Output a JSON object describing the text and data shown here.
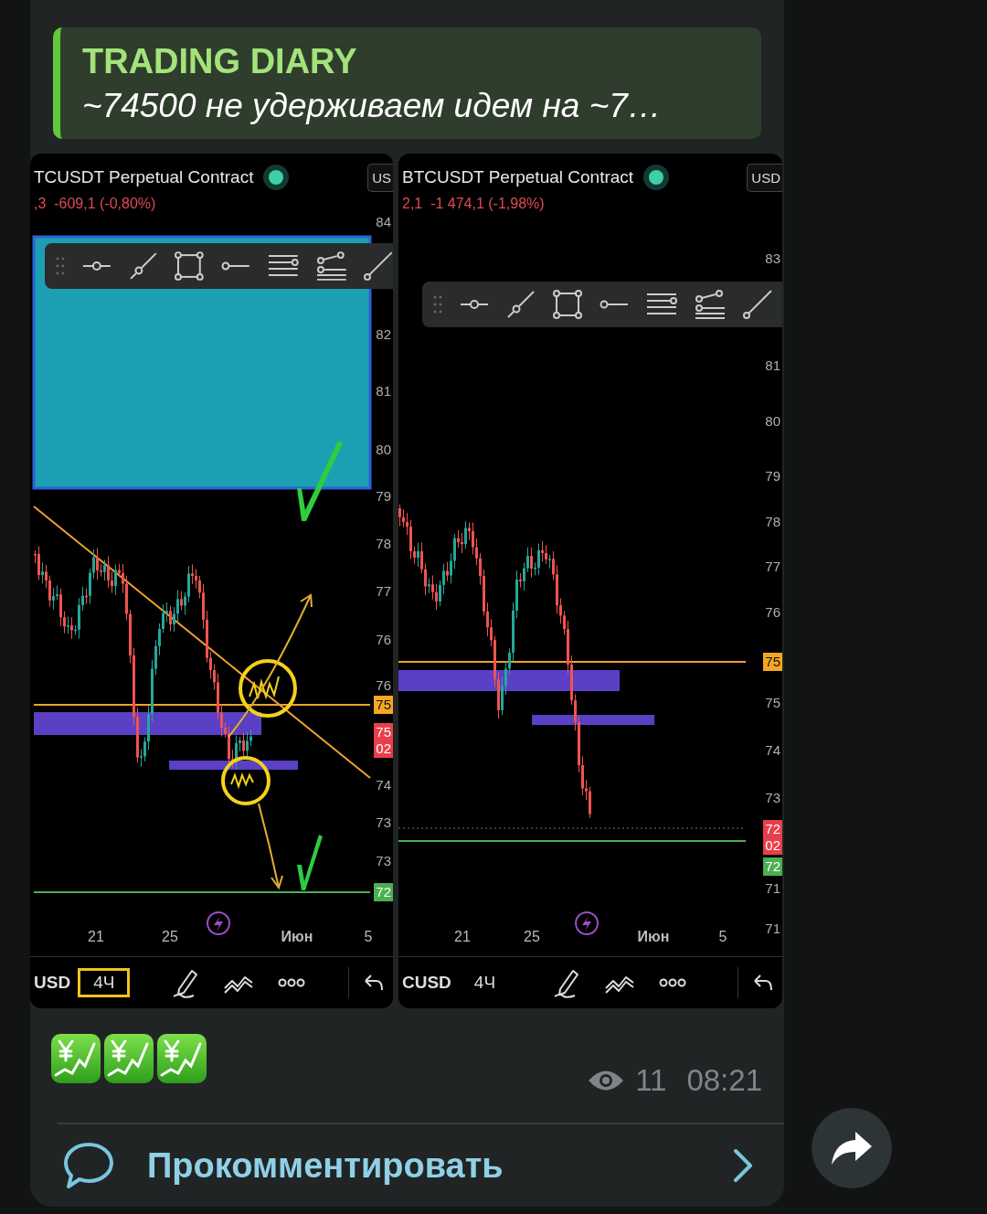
{
  "reply": {
    "title": "TRADING DIARY",
    "text": "~74500 не удерживаем идем на ~7…"
  },
  "charts": [
    {
      "title": "TCUSDT Perpetual Contract",
      "change": ",3  -609,1 (-0,80%)",
      "currency": "US",
      "symbol": "USD",
      "timeframe": {
        "label": "4Ч",
        "selected": true
      },
      "dates": [
        "21",
        "25",
        "Июн",
        "5"
      ],
      "price_labels": [
        {
          "lines": [
            "84"
          ],
          "kind": "plain"
        },
        {
          "lines": [
            "82"
          ],
          "kind": "plain"
        },
        {
          "lines": [
            "81"
          ],
          "kind": "plain"
        },
        {
          "lines": [
            "80"
          ],
          "kind": "plain"
        },
        {
          "lines": [
            "79"
          ],
          "kind": "plain"
        },
        {
          "lines": [
            "78"
          ],
          "kind": "plain"
        },
        {
          "lines": [
            "77"
          ],
          "kind": "plain"
        },
        {
          "lines": [
            "76"
          ],
          "kind": "plain"
        },
        {
          "lines": [
            "76"
          ],
          "kind": "plain"
        },
        {
          "lines": [
            "75"
          ],
          "kind": "orange"
        },
        {
          "lines": [
            "75",
            "02"
          ],
          "kind": "red"
        },
        {
          "lines": [
            "74"
          ],
          "kind": "plain"
        },
        {
          "lines": [
            "73"
          ],
          "kind": "plain"
        },
        {
          "lines": [
            "73"
          ],
          "kind": "plain"
        },
        {
          "lines": [
            "72"
          ],
          "kind": "green"
        }
      ]
    },
    {
      "title": "BTCUSDT Perpetual Contract",
      "change": "2,1  -1 474,1 (-1,98%)",
      "currency": "USD",
      "symbol": "CUSD",
      "timeframe": {
        "label": "4Ч",
        "selected": false
      },
      "dates": [
        "21",
        "25",
        "Июн",
        "5"
      ],
      "price_labels": [
        {
          "lines": [
            "83"
          ],
          "kind": "plain"
        },
        {
          "lines": [
            "81"
          ],
          "kind": "plain"
        },
        {
          "lines": [
            "80"
          ],
          "kind": "plain"
        },
        {
          "lines": [
            "79"
          ],
          "kind": "plain"
        },
        {
          "lines": [
            "78"
          ],
          "kind": "plain"
        },
        {
          "lines": [
            "77"
          ],
          "kind": "plain"
        },
        {
          "lines": [
            "76"
          ],
          "kind": "plain"
        },
        {
          "lines": [
            "75"
          ],
          "kind": "orange"
        },
        {
          "lines": [
            "75"
          ],
          "kind": "plain"
        },
        {
          "lines": [
            "74"
          ],
          "kind": "plain"
        },
        {
          "lines": [
            "73"
          ],
          "kind": "plain"
        },
        {
          "lines": [
            "72",
            "02"
          ],
          "kind": "red"
        },
        {
          "lines": [
            "72"
          ],
          "kind": "green"
        },
        {
          "lines": [
            "71"
          ],
          "kind": "plain"
        },
        {
          "lines": [
            "71"
          ],
          "kind": "plain"
        }
      ]
    }
  ],
  "views": "11",
  "time": "08:21",
  "comment_button": "Прокомментировать"
}
